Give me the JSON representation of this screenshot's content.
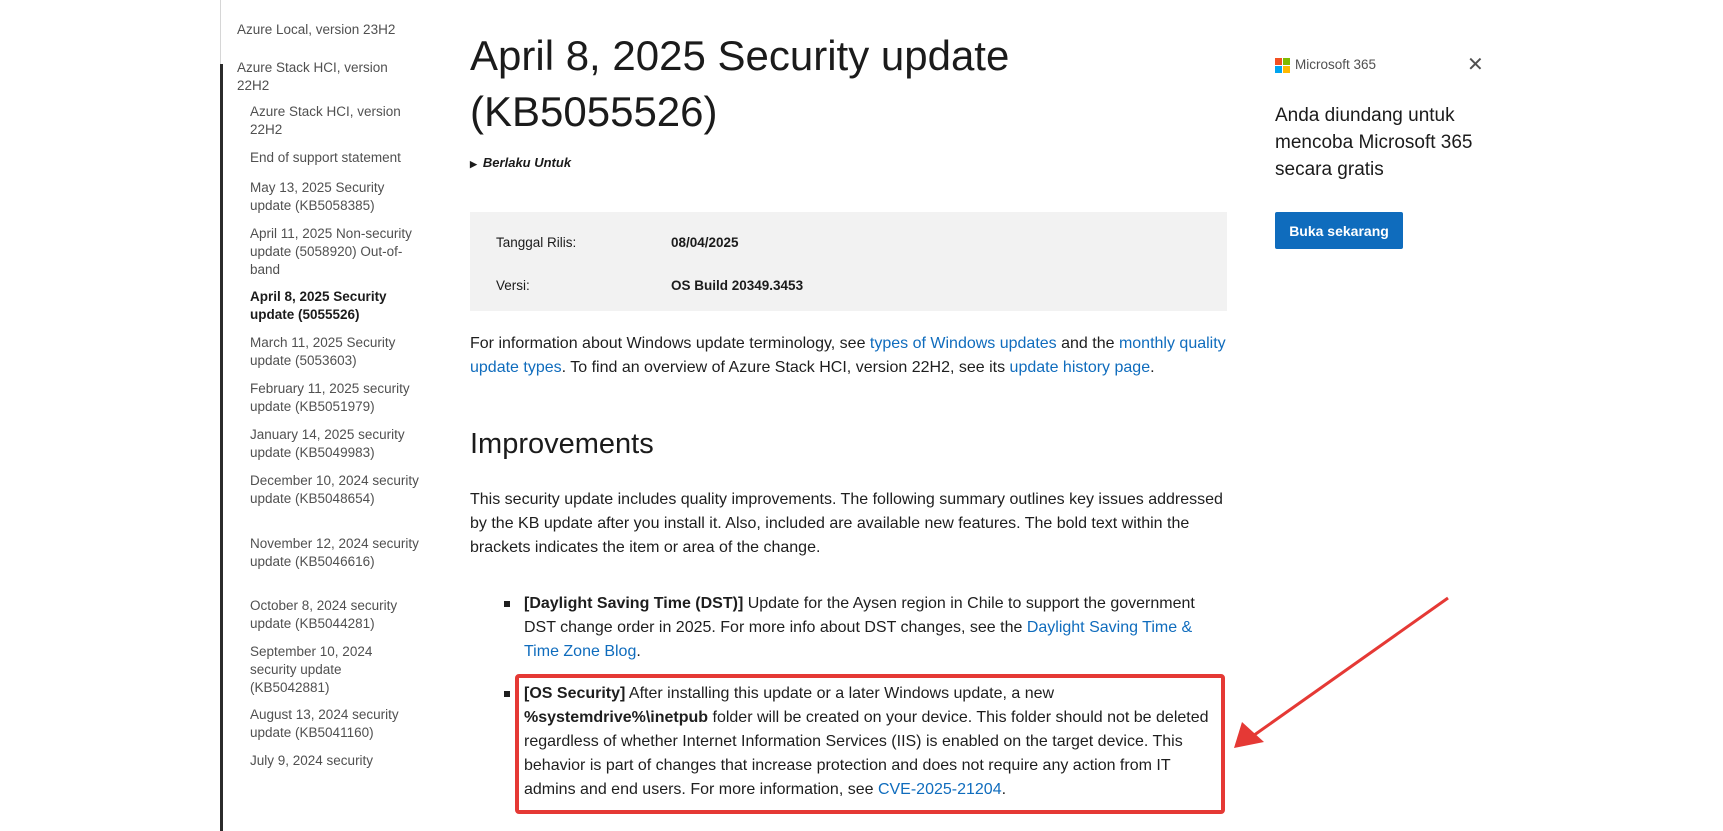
{
  "sidebar": {
    "items": [
      {
        "label": "Azure Local, version 23H2",
        "level": 0,
        "current": false
      },
      {
        "label": "Azure Stack HCI, version 22H2",
        "level": 0,
        "current": false
      },
      {
        "label": "Azure Stack HCI, version 22H2",
        "level": 1,
        "current": false
      },
      {
        "label": "End of support statement",
        "level": 1,
        "current": false
      },
      {
        "label": "May 13, 2025 Security update (KB5058385)",
        "level": 1,
        "current": false
      },
      {
        "label": "April 11, 2025 Non-security update (5058920) Out-of-band",
        "level": 1,
        "current": false
      },
      {
        "label": "April 8, 2025 Security update (5055526)",
        "level": 1,
        "current": true
      },
      {
        "label": "March 11, 2025 Security update (5053603)",
        "level": 1,
        "current": false
      },
      {
        "label": "February 11, 2025 security update (KB5051979)",
        "level": 1,
        "current": false
      },
      {
        "label": "January 14, 2025 security update (KB5049983)",
        "level": 1,
        "current": false
      },
      {
        "label": "December 10, 2024 security update (KB5048654)",
        "level": 1,
        "current": false
      },
      {
        "label": "November 12, 2024 security update (KB5046616)",
        "level": 1,
        "current": false
      },
      {
        "label": "October 8, 2024 security update (KB5044281)",
        "level": 1,
        "current": false
      },
      {
        "label": "September 10, 2024 security update (KB5042881)",
        "level": 1,
        "current": false
      },
      {
        "label": "August 13, 2024 security update (KB5041160)",
        "level": 1,
        "current": false
      },
      {
        "label": "July 9, 2024 security",
        "level": 1,
        "current": false
      }
    ]
  },
  "article": {
    "title": "April 8, 2025 Security update (KB5055526)",
    "applies_to": "Berlaku Untuk",
    "release": {
      "date_label": "Tanggal Rilis:",
      "date_value": "08/04/2025",
      "version_label": "Versi:",
      "version_value": "OS Build 20349.3453"
    },
    "intro": {
      "t1": "For information about Windows update terminology, see ",
      "link1": "types of Windows updates",
      "t2": " and the ",
      "link2": "monthly quality update types",
      "t3": ". To find an overview of Azure Stack HCI, version 22H2, see its ",
      "link3": "update history page",
      "t4": "."
    },
    "improvements_heading": "Improvements",
    "summary": "This security update includes quality improvements. The following summary outlines key issues addressed by the KB update after you install it. Also, included are available new features. The bold text within the brackets indicates the item or area of the change.",
    "bullets": {
      "dst": {
        "tag": "[Daylight Saving Time (DST)]",
        "text": " Update for the Aysen region in Chile to support the government DST change order in 2025. For more info about DST changes, see the ",
        "link": "Daylight Saving Time & Time Zone Blog",
        "end": "."
      },
      "os": {
        "tag": "[OS Security]",
        "t1": " After installing this update or a later Windows update, a new ",
        "path": "%systemdrive%\\inetpub",
        "t2": " folder will be created on your device. This folder should not be deleted regardless of whether Internet Information Services (IIS) is enabled on the target device. This behavior is part of changes that increase protection and does not require any action from IT admins and end users. For more information, see ",
        "link": "CVE-2025-21204",
        "end": "."
      }
    }
  },
  "promo": {
    "brand": "Microsoft 365",
    "close_icon": "close-icon",
    "text": "Anda diundang untuk mencoba Microsoft 365 secara gratis",
    "button": "Buka sekarang",
    "logo_colors": [
      "#f25022",
      "#7fba00",
      "#00a4ef",
      "#ffb900"
    ]
  },
  "annotation": {
    "color": "#e53935"
  }
}
